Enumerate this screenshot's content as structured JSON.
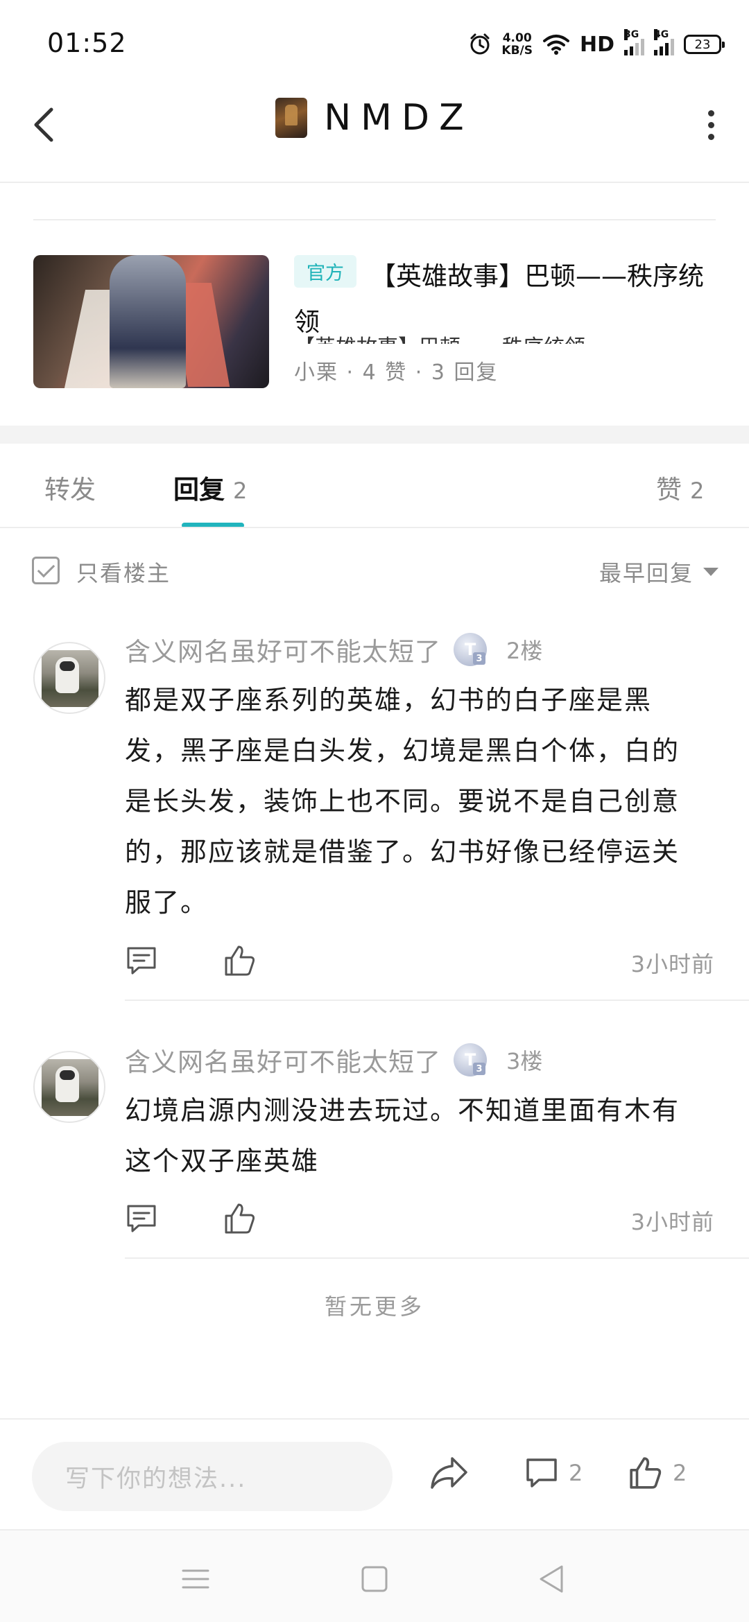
{
  "status_bar": {
    "time": "01:52",
    "net_speed_value": "4.00",
    "net_speed_unit": "KB/S",
    "hd_label": "HD",
    "sim1_label": "3G",
    "sim2_label": "4G",
    "battery": "23"
  },
  "header": {
    "title": "NMDZ"
  },
  "post": {
    "badge": "官方",
    "title": "【英雄故事】巴顿——秩序统领",
    "excerpt": "【英雄故事】巴顿——秩序统领",
    "author": "小栗",
    "likes": "4 赞",
    "replies": "3 回复",
    "separator": " · "
  },
  "tabs": [
    {
      "label": "转发",
      "count": ""
    },
    {
      "label": "回复",
      "count": "2"
    },
    {
      "label": "赞",
      "count": "2"
    }
  ],
  "filter": {
    "only_op": "只看楼主",
    "sort": "最早回复"
  },
  "comments": [
    {
      "username": "含义网名虽好可不能太短了",
      "level_letter": "T",
      "level_num": "3",
      "floor": "2楼",
      "text_lines": [
        "都是双子座系列的英雄，幻书的白子座是黑",
        "发，黑子座是白头发，幻境是黑白个体，白的",
        "是长头发，装饰上也不同。要说不是自己创意",
        "的，那应该就是借鉴了。幻书好像已经停运关",
        "服了。"
      ],
      "time": "3小时前"
    },
    {
      "username": "含义网名虽好可不能太短了",
      "level_letter": "T",
      "level_num": "3",
      "floor": "3楼",
      "text_lines": [
        "幻境启源内测没进去玩过。不知道里面有木有",
        "这个双子座英雄"
      ],
      "time": "3小时前"
    }
  ],
  "no_more": "暂无更多",
  "bottom_bar": {
    "input_placeholder": "写下你的想法...",
    "comment_count": "2",
    "like_count": "2"
  },
  "colors": {
    "accent": "#21b4bd",
    "badge_bg": "#e6f7f7",
    "muted_text": "#9a9a9a"
  },
  "icons": [
    "back-icon",
    "more-icon",
    "reply-icon",
    "like-icon",
    "share-icon",
    "comment-icon",
    "menu-icon",
    "home-icon",
    "nav-back-icon",
    "alarm-icon",
    "wifi-icon"
  ]
}
